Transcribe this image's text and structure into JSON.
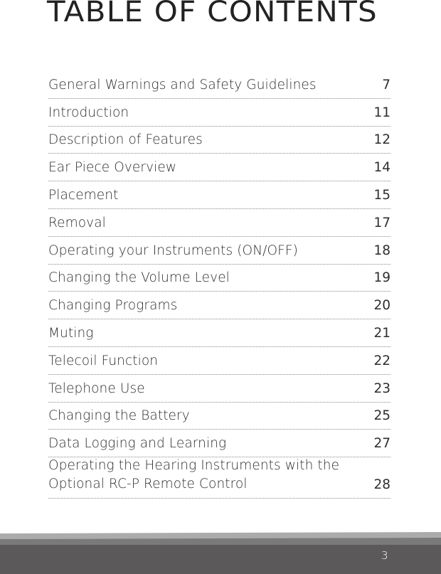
{
  "document": {
    "title": "TABLE OF CONTENTS",
    "entries": [
      {
        "title": "General Warnings and Safety Guidelines",
        "page": "7"
      },
      {
        "title": "Introduction",
        "page": "11"
      },
      {
        "title": "Description of Features",
        "page": "12"
      },
      {
        "title": "Ear Piece Overview",
        "page": "14"
      },
      {
        "title": "Placement",
        "page": "15"
      },
      {
        "title": "Removal",
        "page": "17"
      },
      {
        "title": "Operating your Instruments (ON/OFF)",
        "page": "18"
      },
      {
        "title": "Changing the Volume Level",
        "page": "19"
      },
      {
        "title": "Changing Programs",
        "page": "20"
      },
      {
        "title": "Muting",
        "page": "21"
      },
      {
        "title": "Telecoil Function",
        "page": "22"
      },
      {
        "title": "Telephone Use",
        "page": "23"
      },
      {
        "title": "Changing the Battery",
        "page": "25"
      },
      {
        "title": "Data Logging and Learning",
        "page": "27"
      },
      {
        "title": "Operating the Hearing Instruments with the Optional RC-P Remote Control",
        "page": "28"
      }
    ]
  },
  "footer": {
    "page_number": "3"
  },
  "colors": {
    "text": "#2e2e2e",
    "footer_light": "#ababab",
    "footer_mid": "#7b7a7b",
    "footer_dark": "#5b595a"
  }
}
